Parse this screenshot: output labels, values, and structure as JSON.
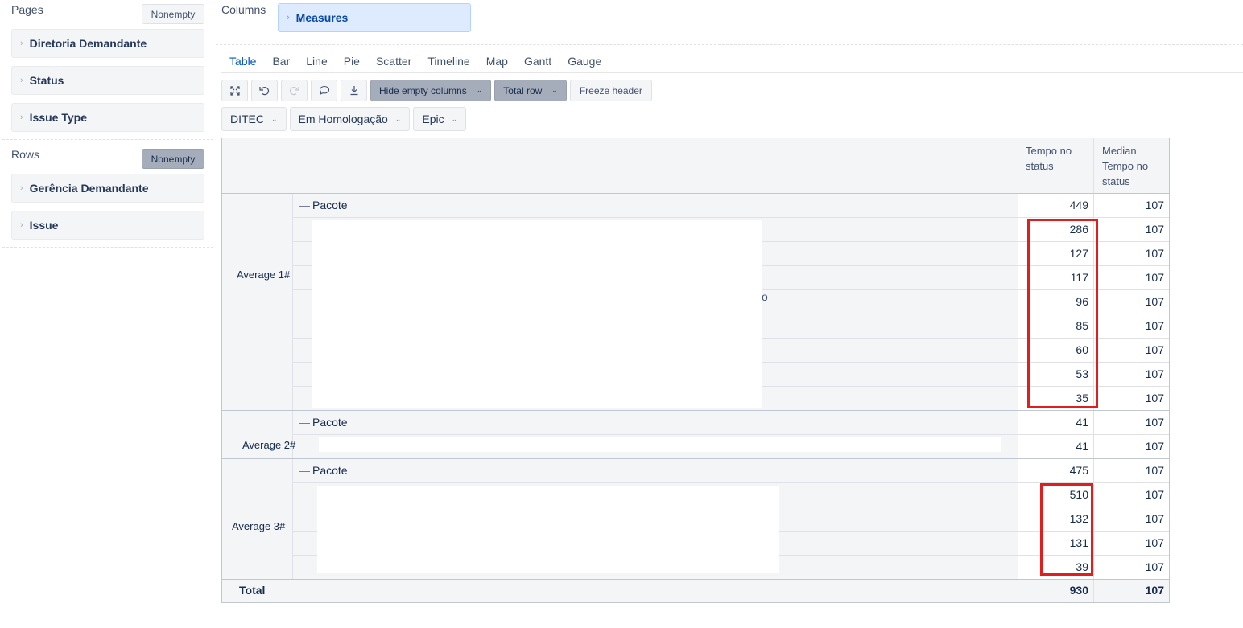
{
  "pages": {
    "header": "Pages",
    "nonempty_label": "Nonempty",
    "dimensions": [
      "Diretoria Demandante",
      "Status",
      "Issue Type"
    ]
  },
  "rows": {
    "header": "Rows",
    "nonempty_label": "Nonempty",
    "dimensions": [
      "Gerência Demandante",
      "Issue"
    ]
  },
  "columns": {
    "header": "Columns",
    "measures_label": "Measures"
  },
  "tabs": [
    "Table",
    "Bar",
    "Line",
    "Pie",
    "Scatter",
    "Timeline",
    "Map",
    "Gantt",
    "Gauge"
  ],
  "active_tab": "Table",
  "toolbar": {
    "hide_empty_label": "Hide empty columns",
    "total_row_label": "Total row",
    "freeze_header_label": "Freeze header"
  },
  "filters": [
    "DITEC",
    "Em Homologação",
    "Epic"
  ],
  "table": {
    "col_headers": [
      "Tempo no status",
      "Median Tempo no status"
    ],
    "groups": [
      {
        "label": "Average 1#",
        "pacote_label": "Pacote",
        "pacote_values": [
          "449",
          "107"
        ],
        "rows": [
          [
            "286",
            "107"
          ],
          [
            "127",
            "107"
          ],
          [
            "117",
            "107"
          ],
          [
            "96",
            "107"
          ],
          [
            "85",
            "107"
          ],
          [
            "60",
            "107"
          ],
          [
            "53",
            "107"
          ],
          [
            "35",
            "107"
          ]
        ],
        "fragment": "o"
      },
      {
        "label": "Average 2#",
        "pacote_label": "Pacote",
        "pacote_values": [
          "41",
          "107"
        ],
        "rows": [
          [
            "41",
            "107"
          ]
        ]
      },
      {
        "label": "Average 3#",
        "pacote_label": "Pacote",
        "pacote_values": [
          "475",
          "107"
        ],
        "rows": [
          [
            "510",
            "107"
          ],
          [
            "132",
            "107"
          ],
          [
            "131",
            "107"
          ],
          [
            "39",
            "107"
          ]
        ]
      }
    ],
    "total_label": "Total",
    "total_values": [
      "930",
      "107"
    ]
  },
  "colors": {
    "accent": "#0052cc",
    "highlight_box": "#e01e1e",
    "chip_bg": "#deebff"
  }
}
